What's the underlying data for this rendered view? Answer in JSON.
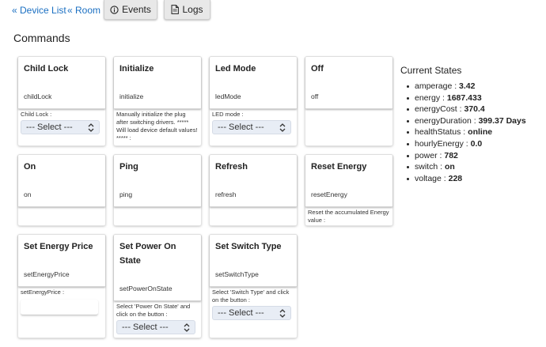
{
  "nav": {
    "device_list": "« Device List",
    "room": "« Room",
    "events": "Events",
    "logs": "Logs"
  },
  "section_title": "Commands",
  "commands": [
    {
      "title": "Child Lock",
      "name": "childLock",
      "arg_label": "Child Lock :",
      "control": "select",
      "select_value": "--- Select ---"
    },
    {
      "title": "Initialize",
      "name": "initialize",
      "arg_label": "Manually initialize the plug after switching drivers. ***** Will load device default values! ***** :",
      "control": "none"
    },
    {
      "title": "Led Mode",
      "name": "ledMode",
      "arg_label": "LED mode :",
      "control": "select",
      "select_value": "--- Select ---"
    },
    {
      "title": "Off",
      "name": "off",
      "arg_label": "",
      "control": "none"
    },
    {
      "title": "On",
      "name": "on",
      "arg_label": "",
      "control": "none"
    },
    {
      "title": "Ping",
      "name": "ping",
      "arg_label": "",
      "control": "none"
    },
    {
      "title": "Refresh",
      "name": "refresh",
      "arg_label": "",
      "control": "none"
    },
    {
      "title": "Reset Energy",
      "name": "resetEnergy",
      "arg_label": "Reset the accumulated Energy value :",
      "control": "none"
    },
    {
      "title": "Set Energy Price",
      "name": "setEnergyPrice",
      "arg_label": "setEnergyPrice :",
      "control": "input"
    },
    {
      "title": "Set Power On State",
      "name": "setPowerOnState",
      "arg_label": "Select 'Power On State' and click on the button :",
      "control": "select",
      "select_value": "--- Select ---"
    },
    {
      "title": "Set Switch Type",
      "name": "setSwitchType",
      "arg_label": "Select 'Switch Type' and click on the button :",
      "control": "select",
      "select_value": "--- Select ---"
    }
  ],
  "current_states": {
    "title": "Current States",
    "items": [
      {
        "key": "amperage",
        "value": "3.42"
      },
      {
        "key": "energy",
        "value": "1687.433"
      },
      {
        "key": "energyCost",
        "value": "370.4"
      },
      {
        "key": "energyDuration",
        "value": "399.37 Days"
      },
      {
        "key": "healthStatus",
        "value": "online"
      },
      {
        "key": "hourlyEnergy",
        "value": "0.0"
      },
      {
        "key": "power",
        "value": "782"
      },
      {
        "key": "switch",
        "value": "on"
      },
      {
        "key": "voltage",
        "value": "228"
      }
    ]
  }
}
